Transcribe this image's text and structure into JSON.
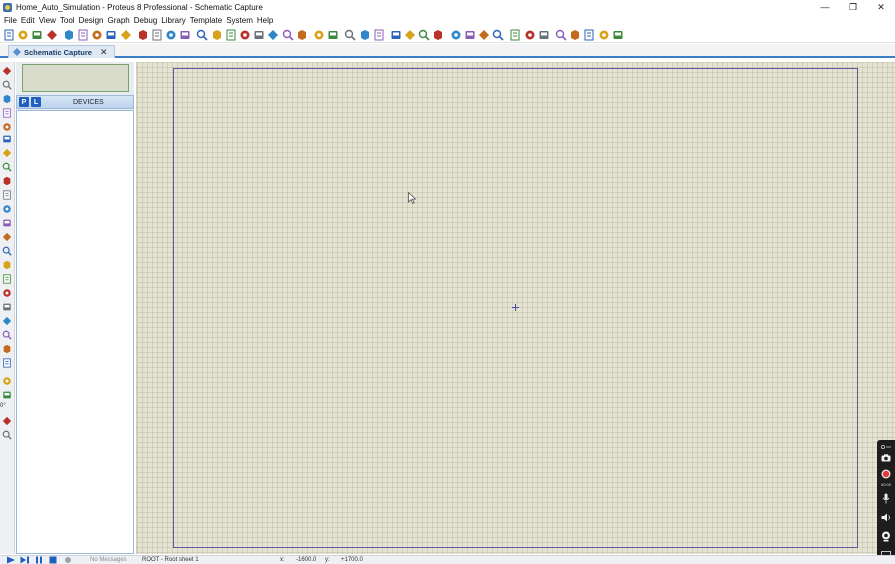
{
  "window": {
    "title": "Home_Auto_Simulation - Proteus 8 Professional - Schematic Capture",
    "minimize_glyph": "—",
    "maximize_glyph": "❐",
    "close_glyph": "✕"
  },
  "menu": {
    "items": [
      "File",
      "Edit",
      "View",
      "Tool",
      "Design",
      "Graph",
      "Debug",
      "Library",
      "Template",
      "System",
      "Help"
    ]
  },
  "toolbar": {
    "icons": [
      "new-file-icon",
      "open-folder-icon",
      "save-icon",
      "import-icon",
      "sep",
      "library-icon",
      "component-icon",
      "back-icon",
      "zoom-area-icon",
      "print-icon",
      "sep",
      "grid-icon",
      "paste-icon",
      "close-doc-icon",
      "help-icon",
      "sep",
      "refresh-icon",
      "grid-toggle-icon",
      "origin-icon",
      "pan-icon",
      "zoom-in-icon",
      "zoom-out-icon",
      "zoom-all-icon",
      "zoom-fit-icon",
      "sep",
      "undo-icon",
      "redo-icon",
      "sep",
      "cut-icon",
      "copy-icon",
      "paste-icon",
      "sep",
      "block-copy-icon",
      "block-move-icon",
      "block-rotate-icon",
      "block-delete-icon",
      "sep",
      "pick-device-icon",
      "make-device-icon",
      "package-icon",
      "decompose-icon",
      "sep",
      "wire-autorouter-icon",
      "search-icon",
      "property-assign-icon",
      "sep",
      "netlist-icon",
      "bom-icon",
      "erc-icon",
      "pcb-icon",
      "design-explorer-icon"
    ]
  },
  "tab": {
    "label": "Schematic Capture",
    "close_glyph": "✕"
  },
  "devices_panel": {
    "pick_button": "P",
    "library_button": "L",
    "title": "DEVICES",
    "items": []
  },
  "left_tools": {
    "rotation_value": "0°",
    "icons": [
      "selection-icon",
      "component-mode-icon",
      "junction-icon",
      "wire-label-icon",
      "text-script-icon",
      "buses-icon",
      "subcircuit-icon",
      "terminals-icon",
      "device-pins-icon",
      "graph-icon",
      "tape-recorder-icon",
      "generator-icon",
      "voltage-probe-icon",
      "virtual-instruments-icon",
      "line-icon",
      "box-icon",
      "circle-icon",
      "arc-icon",
      "path-icon",
      "text-icon",
      "symbol-icon",
      "marker-icon",
      "rotate-cw-icon",
      "rotate-ccw-icon",
      "mirror-x-icon",
      "mirror-y-icon"
    ]
  },
  "canvas": {
    "background_color": "#e5e3d2",
    "sheet_border_color": "#5a5a9a"
  },
  "statusbar": {
    "messages": "No Messages",
    "sheet": "ROOT - Root sheet 1",
    "x_label": "x:",
    "x_value": "-1600.0",
    "y_label": "y:",
    "y_value": "+1700.0"
  },
  "recorder_widget": {
    "time": "00:00"
  }
}
